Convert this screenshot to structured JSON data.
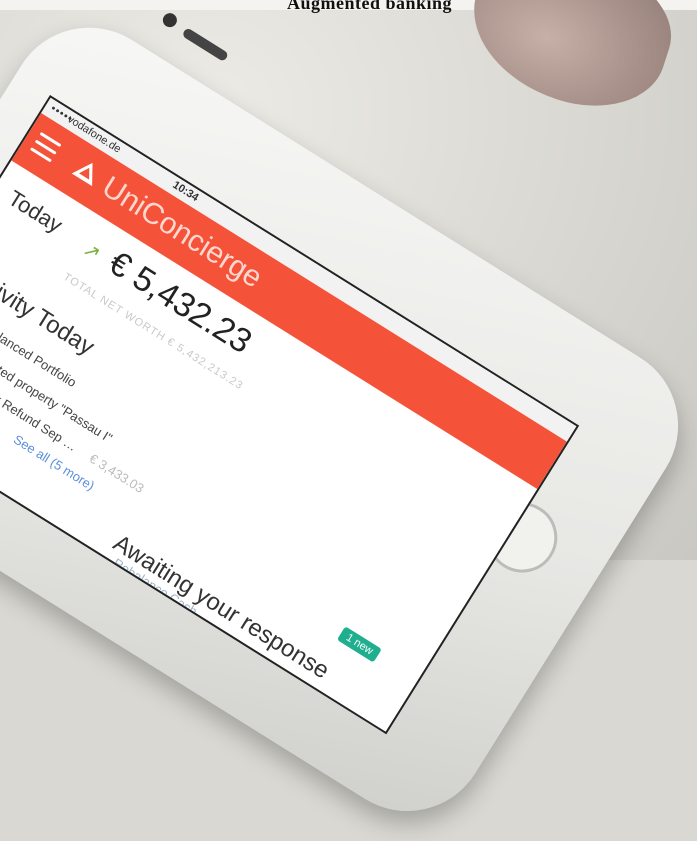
{
  "page_heading": "Augmented banking",
  "status_bar": {
    "carrier": "vodafone.de",
    "time": "10:34",
    "signal": "•••••"
  },
  "app": {
    "title": "UniConcierge",
    "menu_icon": "hamburger-menu-icon",
    "logo_icon": "triangle-logo-icon",
    "brand_color": "#f4533a"
  },
  "summary": {
    "today_label": "Today",
    "trend_icon": "trending-up-icon",
    "balance": "€ 5,432.23",
    "networth": "TOTAL NET WORTH € 5,432,213.23"
  },
  "activity": {
    "title": "Activity Today",
    "items": [
      {
        "label": "Rebalanced Portfolio",
        "amount": ""
      },
      {
        "label": "Revaluated property \"Passau I\"",
        "amount": ""
      },
      {
        "label": "Income Tax Refund Sep …",
        "amount": "€ 3,433.03"
      }
    ],
    "see_all": "See all (5 more)"
  },
  "awaiting": {
    "title": "Awaiting your response",
    "badge": "1 new",
    "badge_color": "#1fae8e",
    "item": "Rebalance Cash"
  }
}
